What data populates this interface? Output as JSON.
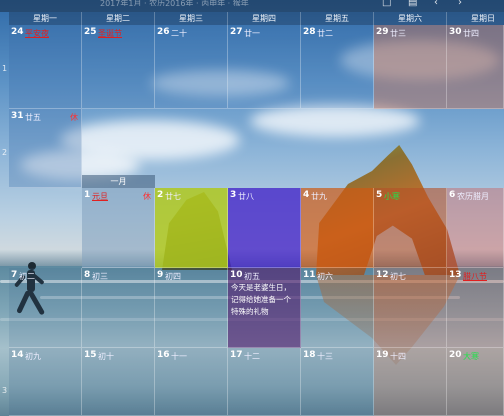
{
  "topbar": {
    "title": "2017年1月 · 农历2016年 · 丙申年 · 猴年",
    "controls": [
      "□",
      "▤",
      "‹",
      "›"
    ]
  },
  "weekdays": [
    "星期一",
    "星期二",
    "星期三",
    "星期四",
    "星期五",
    "星期六",
    "星期日"
  ],
  "week_numbers": [
    "1",
    "2",
    "",
    "",
    "",
    "",
    "3"
  ],
  "month_label": "一月",
  "weeks": [
    [
      {
        "day": "24",
        "lunar": "平安夜",
        "lunar_style": "red",
        "tint": "rgba(60,110,170,0.30)"
      },
      {
        "day": "25",
        "lunar": "圣诞节",
        "lunar_style": "red",
        "tint": "rgba(60,110,170,0.22)"
      },
      {
        "day": "26",
        "lunar": "二十",
        "tint": "rgba(60,110,170,0.18)"
      },
      {
        "day": "27",
        "lunar": "廿一",
        "tint": "rgba(60,110,170,0.12)"
      },
      {
        "day": "28",
        "lunar": "廿二",
        "tint": "rgba(60,110,170,0.12)"
      },
      {
        "day": "29",
        "lunar": "廿三",
        "tint": "rgba(200,110,80,0.45)"
      },
      {
        "day": "30",
        "lunar": "廿四",
        "tint": "rgba(200,110,80,0.45)"
      }
    ],
    [
      {
        "day": "31",
        "lunar": "廿五",
        "tag": "休",
        "tint": "rgba(60,110,170,0.30)"
      }
    ],
    [
      {
        "day": "1",
        "lunar": "元旦",
        "lunar_style": "red",
        "tag": "休",
        "tint": "rgba(130,160,190,0.55)"
      },
      {
        "day": "2",
        "lunar": "廿七",
        "tint": "rgba(175,200,30,0.85)"
      },
      {
        "day": "3",
        "lunar": "廿八",
        "tint": "rgba(70,40,200,0.80)"
      },
      {
        "day": "4",
        "lunar": "廿九",
        "tint": "rgba(205,90,20,0.70)"
      },
      {
        "day": "5",
        "lunar": "小寒",
        "lunar_style": "green",
        "tint": "rgba(180,80,40,0.60)"
      },
      {
        "day": "6",
        "lunar": "农历腊月",
        "tint": "rgba(200,100,100,0.45)"
      }
    ],
    [
      {
        "day": "7",
        "lunar": "初二",
        "tint": "rgba(60,100,140,0.15)"
      },
      {
        "day": "8",
        "lunar": "初三",
        "tint": "rgba(60,100,140,0.15)"
      },
      {
        "day": "9",
        "lunar": "初四",
        "tint": "rgba(60,100,140,0.15)"
      },
      {
        "day": "10",
        "lunar": "初五",
        "note": "今天是老婆生日，记得给她准备一个特殊的礼物",
        "tint": "rgba(80,30,110,0.65)"
      },
      {
        "day": "11",
        "lunar": "初六",
        "tint": "rgba(60,100,140,0.15)"
      },
      {
        "day": "12",
        "lunar": "初七",
        "tint": "rgba(190,90,70,0.30)"
      },
      {
        "day": "13",
        "lunar": "腊八节",
        "lunar_style": "red",
        "tint": "rgba(190,90,70,0.30)"
      }
    ],
    [
      {
        "day": "14",
        "lunar": "初九",
        "tint": "rgba(60,100,140,0.18)"
      },
      {
        "day": "15",
        "lunar": "初十",
        "tint": "rgba(60,100,140,0.18)"
      },
      {
        "day": "16",
        "lunar": "十一",
        "tint": "rgba(60,100,140,0.18)"
      },
      {
        "day": "17",
        "lunar": "十二",
        "tint": "rgba(60,100,140,0.18)"
      },
      {
        "day": "18",
        "lunar": "十三",
        "tint": "rgba(60,100,140,0.18)"
      },
      {
        "day": "19",
        "lunar": "十四",
        "tint": "rgba(190,100,70,0.30)"
      },
      {
        "day": "20",
        "lunar": "大寒",
        "lunar_style": "green",
        "tint": "rgba(190,100,70,0.30)"
      }
    ]
  ]
}
